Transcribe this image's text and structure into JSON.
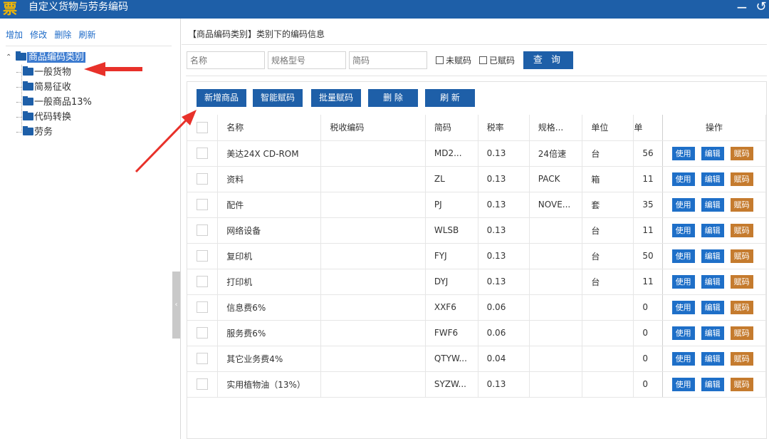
{
  "window": {
    "logo_char": "票",
    "title": "自定义货物与劳务编码",
    "minimize": "−",
    "back": "↺"
  },
  "sidebar": {
    "actions": [
      "增加",
      "修改",
      "删除",
      "刷新"
    ],
    "tree": {
      "root": "商品编码类别",
      "children": [
        "一般货物",
        "简易征收",
        "一般商品13%",
        "代码转换",
        "劳务"
      ]
    },
    "collapse_glyph": "‹"
  },
  "main": {
    "section_title": "【商品编码类别】类别下的编码信息",
    "search": {
      "name_placeholder": "名称",
      "spec_placeholder": "规格型号",
      "short_code_placeholder": "简码",
      "unassigned_label": "未赋码",
      "assigned_label": "已赋码",
      "query_label": "查 询"
    },
    "toolbar": {
      "add": "新增商品",
      "smart_assign": "智能赋码",
      "batch_assign": "批量赋码",
      "delete": "删 除",
      "refresh": "刷 新"
    },
    "table": {
      "headers": {
        "name": "名称",
        "tax_code": "税收编码",
        "short_code": "简码",
        "tax_rate": "税率",
        "spec": "规格...",
        "unit": "单位",
        "unit_price": "单",
        "ops": "操作"
      },
      "op_labels": {
        "use": "使用",
        "edit": "编辑",
        "assign": "赋码"
      },
      "rows": [
        {
          "name": "美达24X CD-ROM",
          "tax_code": "",
          "short_code": "MD2...",
          "tax_rate": "0.13",
          "spec": "24倍速",
          "unit": "台",
          "unit_price": "56"
        },
        {
          "name": "资料",
          "tax_code": "",
          "short_code": "ZL",
          "tax_rate": "0.13",
          "spec": "PACK",
          "unit": "箱",
          "unit_price": "11"
        },
        {
          "name": "配件",
          "tax_code": "",
          "short_code": "PJ",
          "tax_rate": "0.13",
          "spec": "NOVE...",
          "unit": "套",
          "unit_price": "35"
        },
        {
          "name": "网络设备",
          "tax_code": "",
          "short_code": "WLSB",
          "tax_rate": "0.13",
          "spec": "",
          "unit": "台",
          "unit_price": "11"
        },
        {
          "name": "复印机",
          "tax_code": "",
          "short_code": "FYJ",
          "tax_rate": "0.13",
          "spec": "",
          "unit": "台",
          "unit_price": "50"
        },
        {
          "name": "打印机",
          "tax_code": "",
          "short_code": "DYJ",
          "tax_rate": "0.13",
          "spec": "",
          "unit": "台",
          "unit_price": "11"
        },
        {
          "name": "信息费6%",
          "tax_code": "",
          "short_code": "XXF6",
          "tax_rate": "0.06",
          "spec": "",
          "unit": "",
          "unit_price": "0"
        },
        {
          "name": "服务费6%",
          "tax_code": "",
          "short_code": "FWF6",
          "tax_rate": "0.06",
          "spec": "",
          "unit": "",
          "unit_price": "0"
        },
        {
          "name": "其它业务费4%",
          "tax_code": "",
          "short_code": "QTYW...",
          "tax_rate": "0.04",
          "spec": "",
          "unit": "",
          "unit_price": "0"
        },
        {
          "name": "实用植物油（13%）",
          "tax_code": "",
          "short_code": "SYZW...",
          "tax_rate": "0.13",
          "spec": "",
          "unit": "",
          "unit_price": "0"
        }
      ]
    }
  },
  "colors": {
    "titlebar": "#1e5fa8",
    "button": "#1e5fa8",
    "op_blue": "#1e6fc8",
    "op_orange": "#c57b2e",
    "annotation_arrow": "#e8312a"
  }
}
